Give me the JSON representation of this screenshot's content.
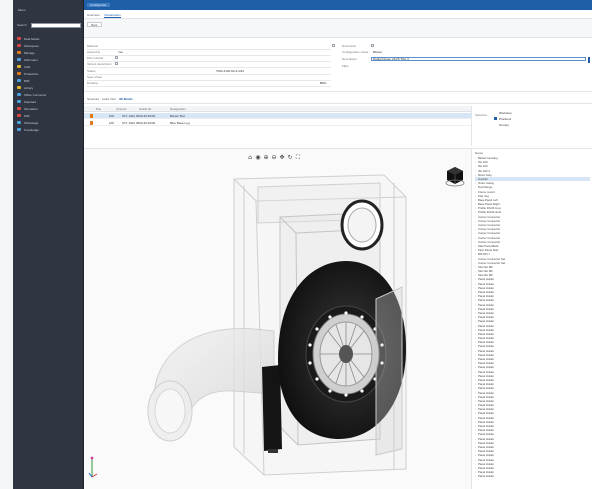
{
  "sidebar": {
    "brand": "Menu",
    "search_label": "Search",
    "items": [
      {
        "label": "Data Model",
        "color": "#d84a3f"
      },
      {
        "label": "Workspace",
        "color": "#d84a3f"
      },
      {
        "label": "Manage",
        "color": "#e07b22"
      },
      {
        "label": "Submodel",
        "color": "#4aa0d8"
      },
      {
        "label": "CAD",
        "color": "#e0b52a"
      },
      {
        "label": "Production",
        "color": "#e07b22"
      },
      {
        "label": "BIM",
        "color": "#4aa0d8"
      },
      {
        "label": "Library",
        "color": "#e0b52a"
      },
      {
        "label": "Office Connector",
        "color": "#4aa0d8"
      },
      {
        "label": "Standard",
        "color": "#4aa0d8"
      },
      {
        "label": "Simulation",
        "color": "#d84a3f"
      },
      {
        "label": "PDF",
        "color": "#d84a3f"
      },
      {
        "label": "Workstage",
        "color": "#4aa0d8"
      },
      {
        "label": "Knowledge",
        "color": "#4aa0d8"
      }
    ]
  },
  "topbar": {
    "crumb": "Configurator"
  },
  "tabs": [
    {
      "label": "Overview",
      "active": false
    },
    {
      "label": "Visualization",
      "active": true
    }
  ],
  "toolbar": {
    "button": "Back"
  },
  "form": {
    "left": [
      {
        "label": "Material",
        "value": ""
      },
      {
        "label": "Assembly",
        "value": "Yes"
      },
      {
        "label": "Part number",
        "value": ""
      },
      {
        "label": "Variant description",
        "value": ""
      },
      {
        "label": "Status",
        "value": ""
      },
      {
        "label": "Spec sheet",
        "value": ""
      },
      {
        "label": "Drawing",
        "value": ""
      }
    ],
    "center_value": "7062-4100 82-4-4/42",
    "drawing_tag": "BDG",
    "right": [
      {
        "label": "Dimension",
        "value": ""
      },
      {
        "label": "Configuration name",
        "value": "Blower"
      },
      {
        "label": "Description",
        "value": "Radial blower 22/25 TDA 4"
      },
      {
        "label": "Filter",
        "value": ""
      }
    ]
  },
  "subtabs": [
    {
      "label": "Structure",
      "active": false
    },
    {
      "label": "Links",
      "active": false
    },
    {
      "label": "Visit",
      "active": false
    },
    {
      "label": "3D-Model",
      "active": true
    }
  ],
  "table": {
    "headers": [
      "Pos",
      "Amount",
      "Article Nr.",
      "Designation"
    ],
    "rows": [
      {
        "pos": "",
        "amount": "100",
        "article": "ST1 1022 3060-40 60/40",
        "name": "Blower Box",
        "selected": true
      },
      {
        "pos": "",
        "amount": "100",
        "article": "ST1 1022 3060-40 60/40",
        "name": "Blue Base Leg",
        "selected": false
      }
    ]
  },
  "props": {
    "label": "Selection",
    "options": [
      {
        "label": "Workstep",
        "checked": false
      },
      {
        "label": "Positions",
        "checked": true
      },
      {
        "label": "Groups",
        "checked": false
      }
    ]
  },
  "viewer": {
    "tools": [
      "⌂",
      "◉",
      "⊕",
      "⊖",
      "✥",
      "↻",
      "⛶"
    ]
  },
  "tree": {
    "header": "Name",
    "items": [
      {
        "label": "Blower Housing",
        "selected": false
      },
      {
        "label": "ISL 100",
        "selected": false
      },
      {
        "label": "ISL 100",
        "selected": false
      },
      {
        "label": "ISL 100 4",
        "selected": false
      },
      {
        "label": "Motor Assy",
        "selected": false
      },
      {
        "label": "Impeller",
        "selected": true
      },
      {
        "label": "Outer casing",
        "selected": false
      },
      {
        "label": "Duct flange",
        "selected": false
      },
      {
        "label": "Frame mount",
        "selected": false
      },
      {
        "label": "Inlet ring",
        "selected": false
      },
      {
        "label": "Base Panel Left",
        "selected": false
      },
      {
        "label": "Base Panel Right",
        "selected": false
      },
      {
        "label": "Profile 30x30 long",
        "selected": false
      },
      {
        "label": "Profile 30x30 short",
        "selected": false
      },
      {
        "label": "Corner Connector",
        "selected": false
      },
      {
        "label": "Corner Connector",
        "selected": false
      },
      {
        "label": "Corner Connector",
        "selected": false
      },
      {
        "label": "Corner Connector",
        "selected": false
      },
      {
        "label": "Corner Connector",
        "selected": false
      },
      {
        "label": "Corner Connector",
        "selected": false
      },
      {
        "label": "Corner Connector",
        "selected": false
      },
      {
        "label": "Side Panel Back",
        "selected": false
      },
      {
        "label": "Plexi Panel Side",
        "selected": false
      },
      {
        "label": "M6 DIN 7",
        "selected": false
      },
      {
        "label": "Corner Connector Set",
        "selected": false
      },
      {
        "label": "Corner Connector Set",
        "selected": false
      },
      {
        "label": "Slot Nut M6",
        "selected": false
      },
      {
        "label": "Slot Nut M6",
        "selected": false
      },
      {
        "label": "Slot Nut M6",
        "selected": false
      },
      {
        "label": "Panel Holder",
        "selected": false
      },
      {
        "label": "Panel Holder",
        "selected": false
      },
      {
        "label": "Panel Holder",
        "selected": false
      },
      {
        "label": "Panel Holder",
        "selected": false
      },
      {
        "label": "Panel Holder",
        "selected": false
      },
      {
        "label": "Panel Holder",
        "selected": false
      },
      {
        "label": "Panel Holder",
        "selected": false
      },
      {
        "label": "Panel Holder",
        "selected": false
      },
      {
        "label": "Panel Holder",
        "selected": false
      },
      {
        "label": "Panel Holder",
        "selected": false
      },
      {
        "label": "Panel Holder",
        "selected": false
      },
      {
        "label": "Panel Holder",
        "selected": false
      },
      {
        "label": "Panel Holder",
        "selected": false
      },
      {
        "label": "Panel Holder",
        "selected": false
      },
      {
        "label": "Panel Holder",
        "selected": false
      },
      {
        "label": "Panel Holder",
        "selected": false
      },
      {
        "label": "Panel Holder",
        "selected": false
      },
      {
        "label": "Panel Holder",
        "selected": false
      },
      {
        "label": "Panel Holder",
        "selected": false
      },
      {
        "label": "Panel Holder",
        "selected": false
      },
      {
        "label": "Panel Holder",
        "selected": false
      },
      {
        "label": "Panel Holder",
        "selected": false
      },
      {
        "label": "Panel Holder",
        "selected": false
      },
      {
        "label": "Panel Holder",
        "selected": false
      },
      {
        "label": "Panel Holder",
        "selected": false
      },
      {
        "label": "Panel Holder",
        "selected": false
      },
      {
        "label": "Panel Holder",
        "selected": false
      },
      {
        "label": "Panel Holder",
        "selected": false
      },
      {
        "label": "Panel Holder",
        "selected": false
      },
      {
        "label": "Panel Holder",
        "selected": false
      },
      {
        "label": "Panel Holder",
        "selected": false
      },
      {
        "label": "Panel Holder",
        "selected": false
      },
      {
        "label": "Panel Holder",
        "selected": false
      },
      {
        "label": "Panel Holder",
        "selected": false
      },
      {
        "label": "Panel Holder",
        "selected": false
      },
      {
        "label": "Panel Holder",
        "selected": false
      },
      {
        "label": "Panel Holder",
        "selected": false
      },
      {
        "label": "Panel Holder",
        "selected": false
      },
      {
        "label": "Panel Holder",
        "selected": false
      },
      {
        "label": "Panel Holder",
        "selected": false
      },
      {
        "label": "Panel Holder",
        "selected": false
      },
      {
        "label": "Panel Holder",
        "selected": false
      },
      {
        "label": "Panel Holder",
        "selected": false
      },
      {
        "label": "Panel Holder",
        "selected": false
      },
      {
        "label": "Panel Holder",
        "selected": false
      },
      {
        "label": "Panel Holder",
        "selected": false
      },
      {
        "label": "Panel Holder",
        "selected": false
      },
      {
        "label": "Panel Holder",
        "selected": false
      }
    ]
  }
}
